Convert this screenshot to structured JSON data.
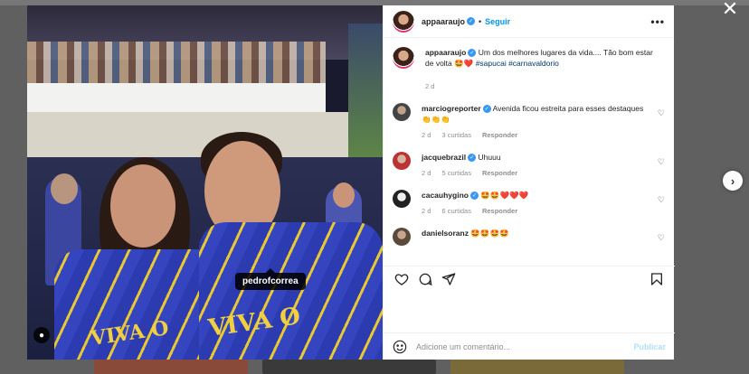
{
  "post": {
    "tag_label": "pedrofcorrea"
  },
  "header": {
    "username": "appaaraujo",
    "separator": "•",
    "follow_label": "Seguir",
    "more_label": "•••"
  },
  "caption": {
    "username": "appaaraujo",
    "text": "Um dos melhores lugares da vida.... Tão bom estar de volta 🤩❤️",
    "hashtags": "#sapucai #carnavaldorio",
    "time": "2 d"
  },
  "comments": [
    {
      "username": "marciogreporter",
      "text": "Avenida ficou estreita para esses destaques 👏👏👏",
      "time": "2 d",
      "likes": "3 curtidas",
      "reply": "Responder"
    },
    {
      "username": "jacquebrazil",
      "text": "Uhuuu",
      "time": "2 d",
      "likes": "5 curtidas",
      "reply": "Responder"
    },
    {
      "username": "cacauhygino",
      "text": "🤩🤩❤️❤️❤️",
      "time": "2 d",
      "likes": "6 curtidas",
      "reply": "Responder"
    },
    {
      "username": "danielsoranz",
      "text": "🤩🤩🤩🤩",
      "time": "",
      "likes": "",
      "reply": ""
    }
  ],
  "icons": {
    "close": "close-icon",
    "next": "chevron-right-icon",
    "like": "heart-icon",
    "comment": "comment-icon",
    "share": "share-icon",
    "save": "bookmark-icon",
    "emoji": "emoji-icon"
  },
  "add_comment": {
    "placeholder": "Adicione um comentário...",
    "post_label": "Publicar"
  },
  "colors": {
    "link": "#0095f6",
    "verified": "#3897f0",
    "muted": "#8e8e8e",
    "post_disabled": "#b2dffc"
  }
}
